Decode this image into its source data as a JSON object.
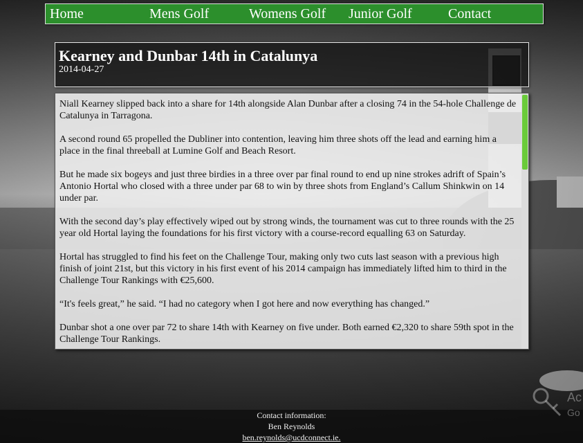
{
  "nav": {
    "items": [
      {
        "label": "Home"
      },
      {
        "label": "Mens Golf"
      },
      {
        "label": "Womens Golf"
      },
      {
        "label": "Junior Golf"
      },
      {
        "label": "Contact"
      }
    ],
    "bg_color": "#2c8f2c"
  },
  "article": {
    "title": "Kearney and Dunbar 14th in Catalunya",
    "date": "2014-04-27",
    "paragraphs": [
      "Niall Kearney slipped back into a share for 14th alongside Alan Dunbar after a closing 74 in the 54-hole Challenge de Catalunya in Tarragona.",
      "A second round 65 propelled the Dubliner into contention, leaving him three shots off the lead and earning him a place in the final threeball at Lumine Golf and Beach Resort.",
      "But he made six bogeys and just three birdies in a three over par final round to end up nine strokes adrift of Spain’s Antonio Hortal who closed with a three under par 68 to win by three shots from England’s Callum Shinkwin on 14 under par.",
      "With the second day’s play effectively wiped out by strong winds, the tournament was cut to three rounds with the 25 year old Hortal laying the foundations for his first victory with a course-record equalling 63 on Saturday.",
      "Hortal has struggled to find his feet on the Challenge Tour, making only two cuts last season with a previous high finish of joint 21st, but this victory in his first event of his 2014 campaign has immediately lifted him to third in the Challenge Tour Rankings with €25,600.",
      "“It's feels great,” he said. “I had no category when I got here and now everything has changed.”",
      "Dunbar shot a one over par 72 to share 14th with Kearney on five under. Both earned €2,320 to share 59th spot in the Challenge Tour Rankings."
    ],
    "scroll_thumb_color": "#6acb3a"
  },
  "footer": {
    "heading": "Contact information:",
    "name": "Ben Reynolds",
    "email": "ben.reynolds@ucdconnect.ie."
  },
  "watermark": {
    "line1": "Ac",
    "line2": "Go"
  }
}
